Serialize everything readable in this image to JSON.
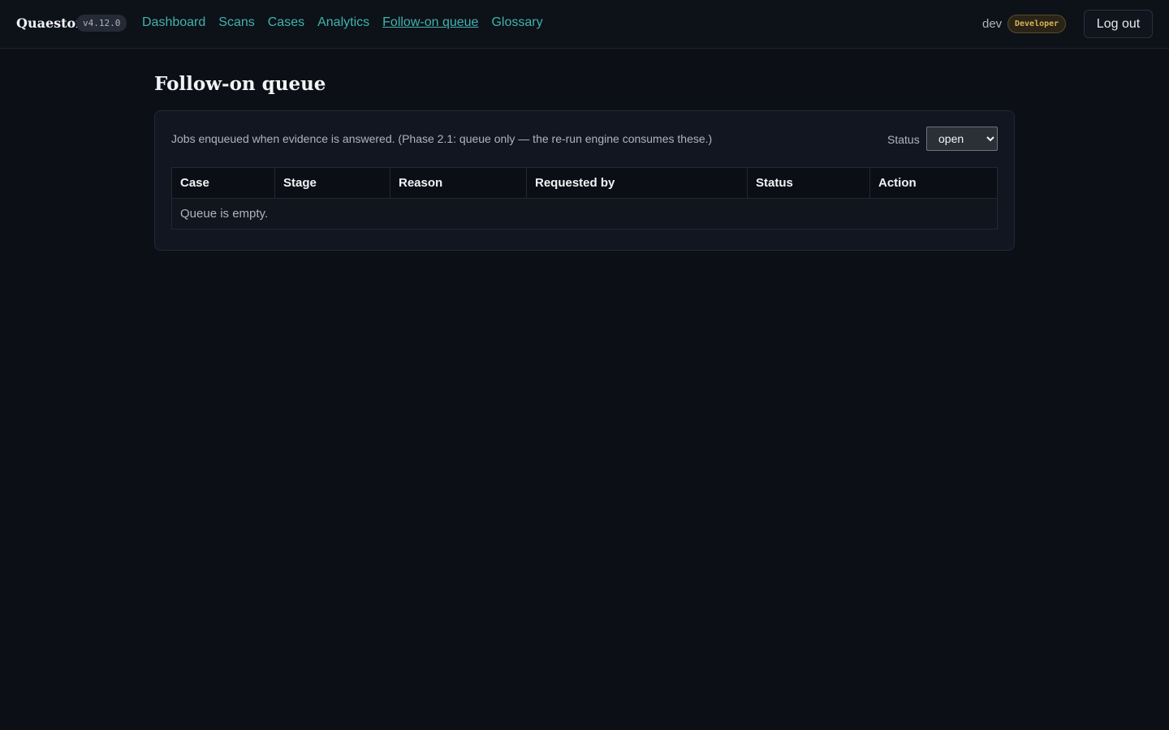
{
  "app": {
    "brand": "Quaestor",
    "version": "v4.12.0"
  },
  "nav": {
    "items": [
      {
        "label": "Dashboard",
        "active": false
      },
      {
        "label": "Scans",
        "active": false
      },
      {
        "label": "Cases",
        "active": false
      },
      {
        "label": "Analytics",
        "active": false
      },
      {
        "label": "Follow-on queue",
        "active": true
      },
      {
        "label": "Glossary",
        "active": false
      }
    ]
  },
  "user": {
    "name": "dev",
    "role": "Developer",
    "logout_label": "Log out"
  },
  "page": {
    "title": "Follow-on queue",
    "description": "Jobs enqueued when evidence is answered. (Phase 2.1: queue only — the re-run engine consumes these.)"
  },
  "filter": {
    "label": "Status",
    "selected": "open"
  },
  "table": {
    "columns": [
      "Case",
      "Stage",
      "Reason",
      "Requested by",
      "Status",
      "Action"
    ],
    "empty_message": "Queue is empty."
  },
  "colors": {
    "accent": "#3fb4ae",
    "background": "#0c0f16",
    "role_badge": "#d8b25a"
  }
}
